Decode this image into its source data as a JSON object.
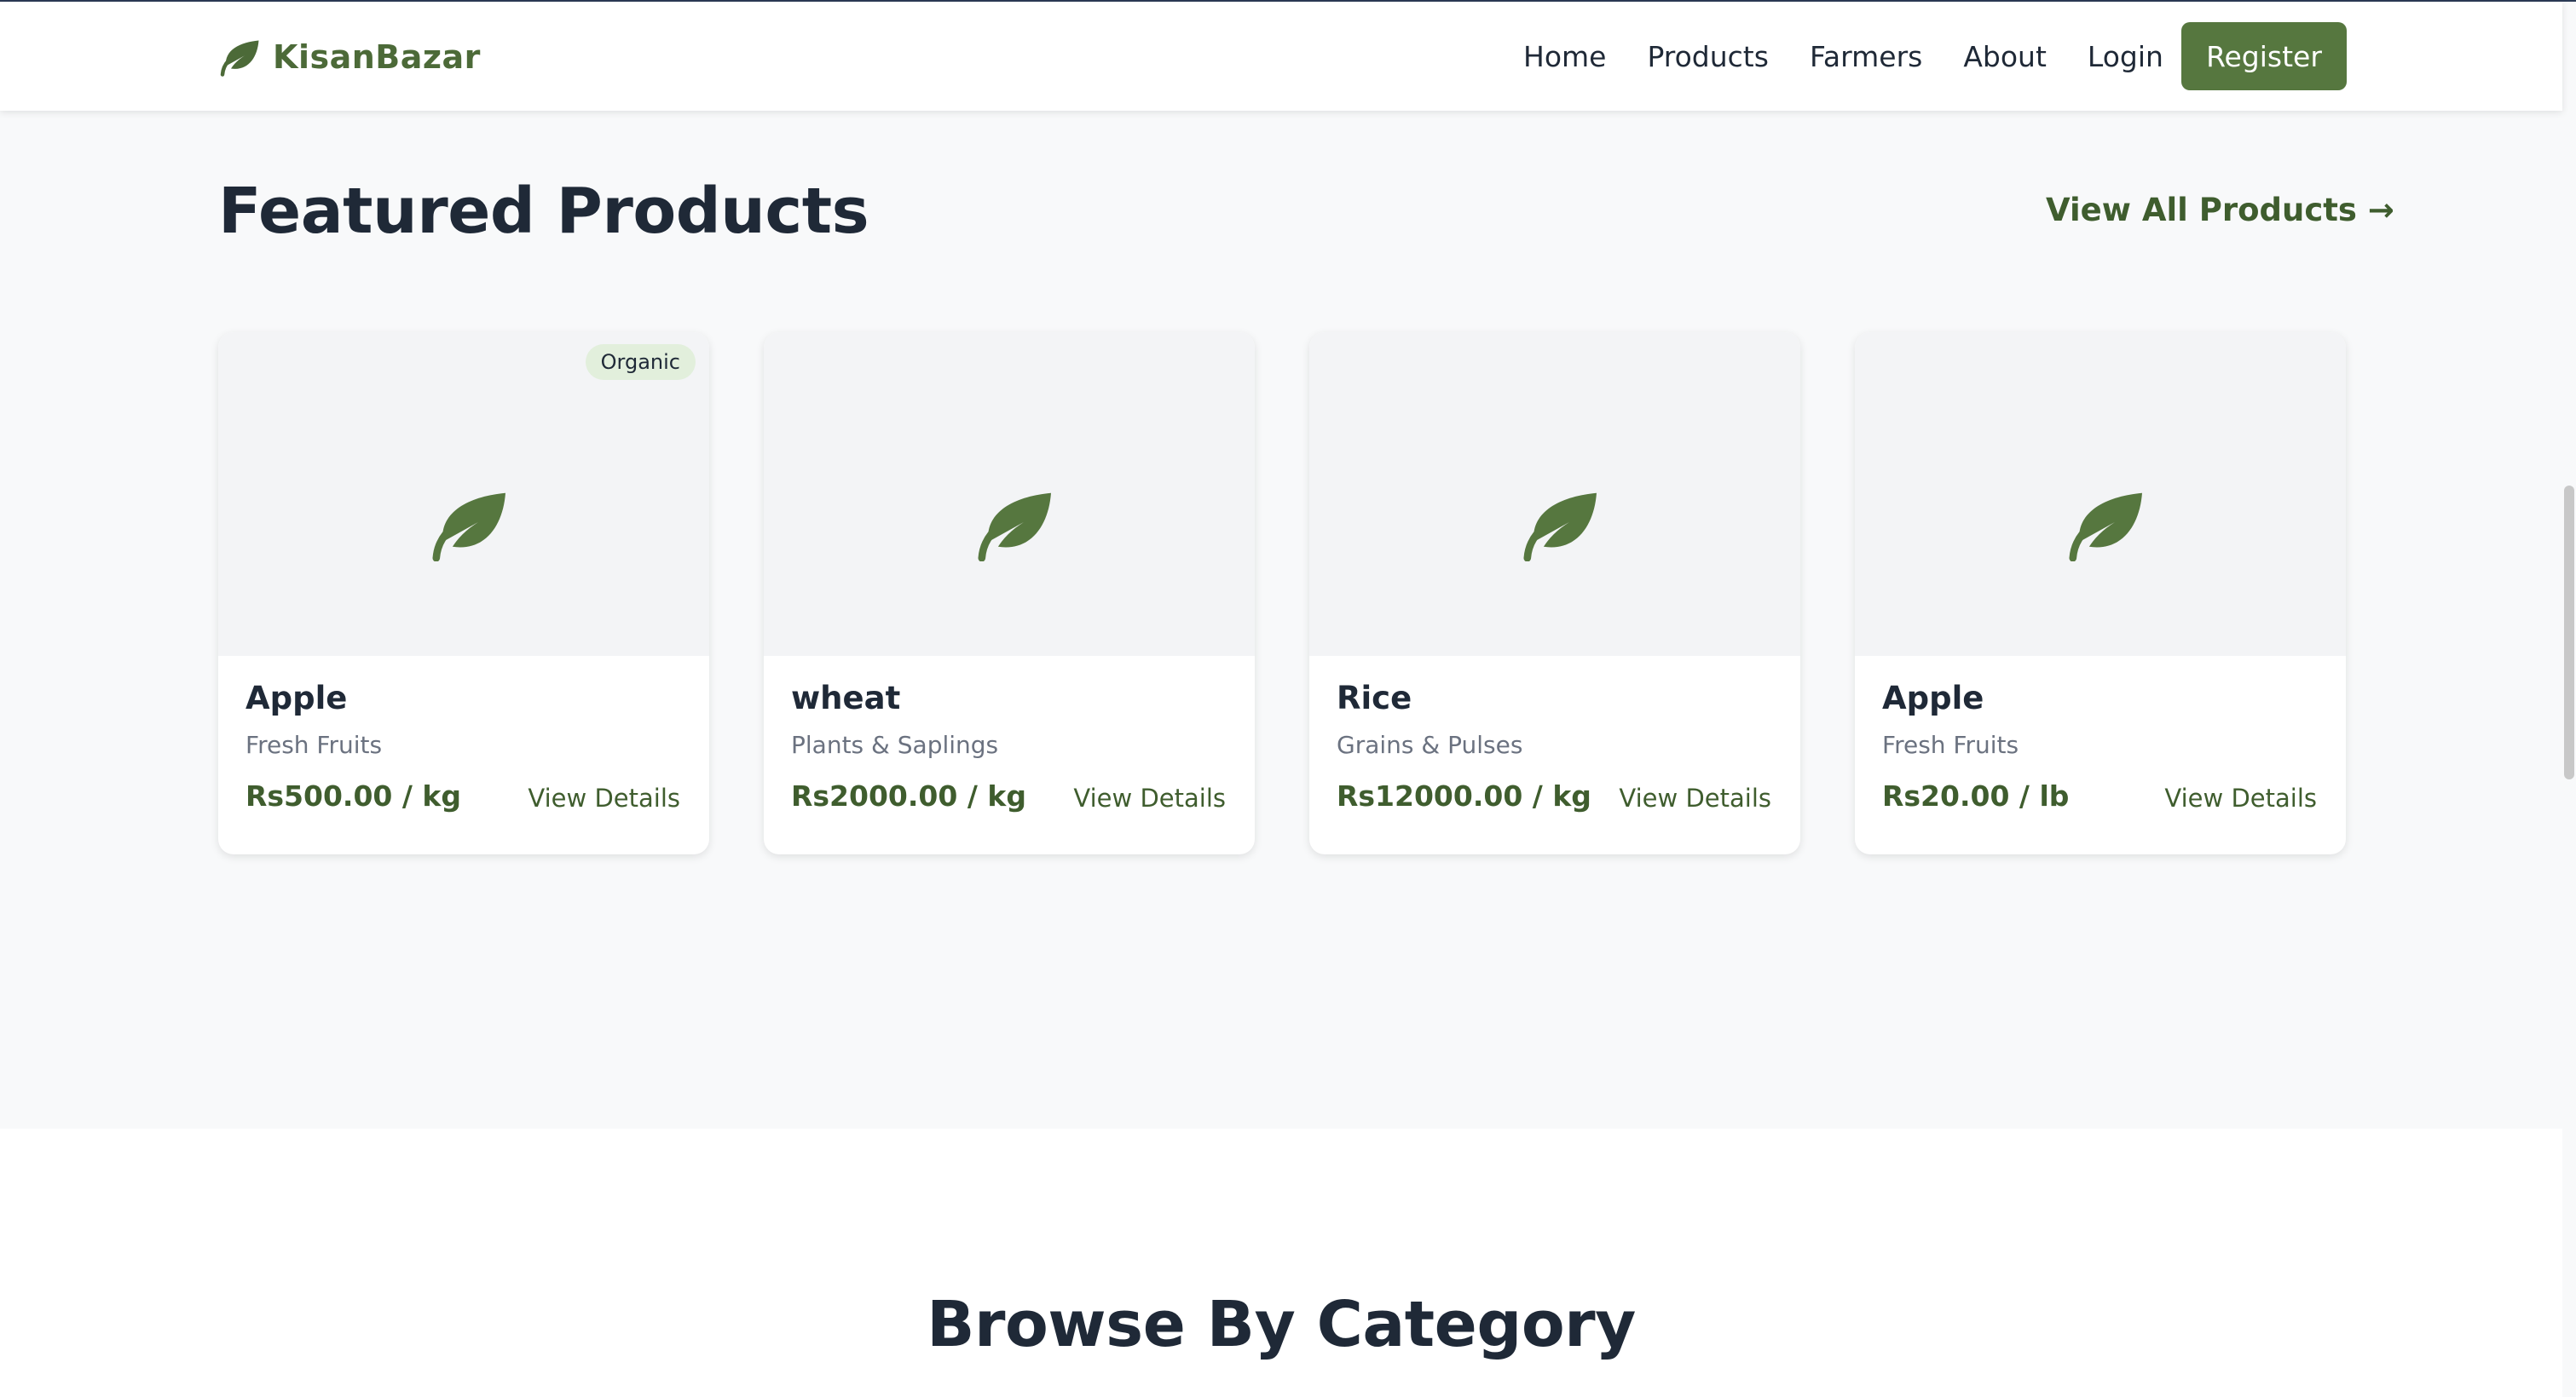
{
  "brand": {
    "name": "KisanBazar",
    "color": "#4c6a38"
  },
  "nav": {
    "links": [
      "Home",
      "Products",
      "Farmers",
      "About",
      "Login"
    ],
    "register_label": "Register"
  },
  "featured": {
    "title": "Featured Products",
    "view_all_label": "View All Products →",
    "products": [
      {
        "name": "Apple",
        "category": "Fresh Fruits",
        "price": "Rs500.00 / kg",
        "badge": "Organic",
        "link_label": "View Details"
      },
      {
        "name": "wheat",
        "category": "Plants & Saplings",
        "price": "Rs2000.00 / kg",
        "badge": "",
        "link_label": "View Details"
      },
      {
        "name": "Rice",
        "category": "Grains & Pulses",
        "price": "Rs12000.00 / kg",
        "badge": "",
        "link_label": "View Details"
      },
      {
        "name": "Apple",
        "category": "Fresh Fruits",
        "price": "Rs20.00 / lb",
        "badge": "",
        "link_label": "View Details"
      }
    ]
  },
  "browse": {
    "title": "Browse By Category"
  },
  "colors": {
    "accent": "#56773f",
    "text_dark": "#1f2937",
    "price_green": "#3f5d2e",
    "badge_bg": "#e2efdc"
  }
}
